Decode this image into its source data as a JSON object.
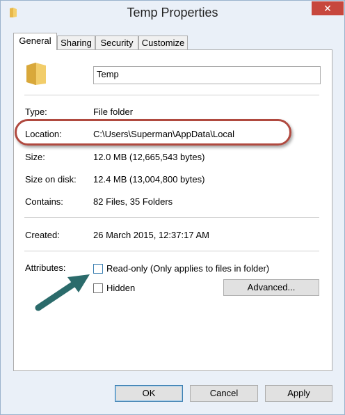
{
  "window": {
    "title": "Temp Properties",
    "close_glyph": "✕"
  },
  "tabs": [
    {
      "label": "General",
      "active": true
    },
    {
      "label": "Sharing"
    },
    {
      "label": "Security"
    },
    {
      "label": "Customize"
    }
  ],
  "general": {
    "folder_name": "Temp",
    "properties": {
      "type": {
        "label": "Type:",
        "value": "File folder"
      },
      "location": {
        "label": "Location:",
        "value": "C:\\Users\\Superman\\AppData\\Local"
      },
      "size": {
        "label": "Size:",
        "value": "12.0 MB (12,665,543 bytes)"
      },
      "size_on_disk": {
        "label": "Size on disk:",
        "value": "12.4 MB (13,004,800 bytes)"
      },
      "contains": {
        "label": "Contains:",
        "value": "82 Files, 35 Folders"
      },
      "created": {
        "label": "Created:",
        "value": "26 March 2015, 12:37:17 AM"
      }
    },
    "attributes": {
      "label": "Attributes:",
      "read_only": {
        "label": "Read-only (Only applies to files in folder)",
        "checked": false
      },
      "hidden": {
        "label": "Hidden",
        "checked": false
      },
      "advanced_label": "Advanced..."
    }
  },
  "footer": {
    "ok": "OK",
    "cancel": "Cancel",
    "apply": "Apply"
  },
  "annotation": {
    "highlight_color": "#b0493f",
    "arrow_color": "#2b6b6b"
  }
}
